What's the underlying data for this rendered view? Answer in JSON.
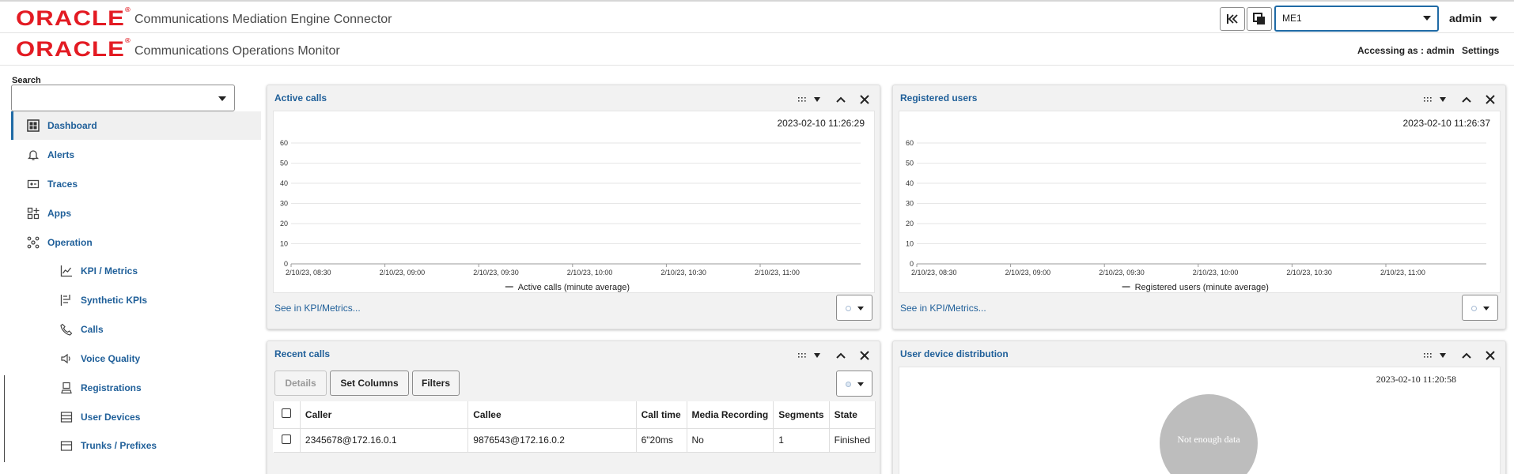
{
  "header": {
    "logo_text": "ORACLE",
    "app_title": "Communications Mediation Engine Connector",
    "me_select_value": "ME1",
    "user": "admin",
    "icons": [
      "rewind-icon",
      "copy-windows-icon",
      "chevron-down-icon"
    ]
  },
  "subheader": {
    "logo_text": "ORACLE",
    "app_title": "Communications Operations Monitor",
    "accessing": "Accessing as : admin",
    "settings": "Settings"
  },
  "sidebar": {
    "search_label": "Search",
    "items": [
      {
        "label": "Dashboard",
        "icon": "dashboard-icon",
        "active": true
      },
      {
        "label": "Alerts",
        "icon": "bell-icon"
      },
      {
        "label": "Traces",
        "icon": "trace-icon"
      },
      {
        "label": "Apps",
        "icon": "apps-icon"
      },
      {
        "label": "Operation",
        "icon": "operation-icon"
      },
      {
        "label": "KPI / Metrics",
        "icon": "chart-icon"
      },
      {
        "label": "Synthetic KPIs",
        "icon": "synthetic-icon"
      },
      {
        "label": "Calls",
        "icon": "phone-icon"
      },
      {
        "label": "Voice Quality",
        "icon": "speaker-icon"
      },
      {
        "label": "Registrations",
        "icon": "registration-icon"
      },
      {
        "label": "User Devices",
        "icon": "devices-icon"
      },
      {
        "label": "Trunks / Prefixes",
        "icon": "trunk-icon"
      }
    ]
  },
  "panels": {
    "active_calls": {
      "title": "Active calls",
      "timestamp": "2023-02-10 11:26:29",
      "link": "See in KPI/Metrics..."
    },
    "registered_users": {
      "title": "Registered users",
      "timestamp": "2023-02-10 11:26:37",
      "link": "See in KPI/Metrics..."
    },
    "recent_calls": {
      "title": "Recent calls",
      "buttons": {
        "details": "Details",
        "set_columns": "Set Columns",
        "filters": "Filters"
      },
      "columns": [
        "Caller",
        "Callee",
        "Call time",
        "Media Recording",
        "Segments",
        "State"
      ],
      "rows": [
        {
          "caller": "2345678@172.16.0.1",
          "callee": "9876543@172.16.0.2",
          "call_time": "6\"20ms",
          "media_recording": "No",
          "segments": "1",
          "state": "Finished"
        }
      ]
    },
    "user_device_distribution": {
      "title": "User device distribution",
      "timestamp": "2023-02-10 11:20:58",
      "empty_text": "Not enough data"
    }
  },
  "chart_data": [
    {
      "type": "line",
      "y_ticks": [
        "60",
        "50",
        "40",
        "30",
        "20",
        "10",
        "0"
      ],
      "ylim": [
        0,
        60
      ],
      "x_ticks": [
        "2/10/23, 08:30",
        "2/10/23, 09:00",
        "2/10/23, 09:30",
        "2/10/23, 10:00",
        "2/10/23, 10:30",
        "2/10/23, 11:00"
      ],
      "series": [
        {
          "name": "Active calls (minute average)",
          "values": []
        }
      ],
      "legend": "bottom",
      "grid": true
    },
    {
      "type": "line",
      "y_ticks": [
        "60",
        "50",
        "40",
        "30",
        "20",
        "10",
        "0"
      ],
      "ylim": [
        0,
        60
      ],
      "x_ticks": [
        "2/10/23, 08:30",
        "2/10/23, 09:00",
        "2/10/23, 09:30",
        "2/10/23, 10:00",
        "2/10/23, 10:30",
        "2/10/23, 11:00"
      ],
      "series": [
        {
          "name": "Registered users (minute average)",
          "values": []
        }
      ],
      "legend": "bottom",
      "grid": true
    }
  ]
}
